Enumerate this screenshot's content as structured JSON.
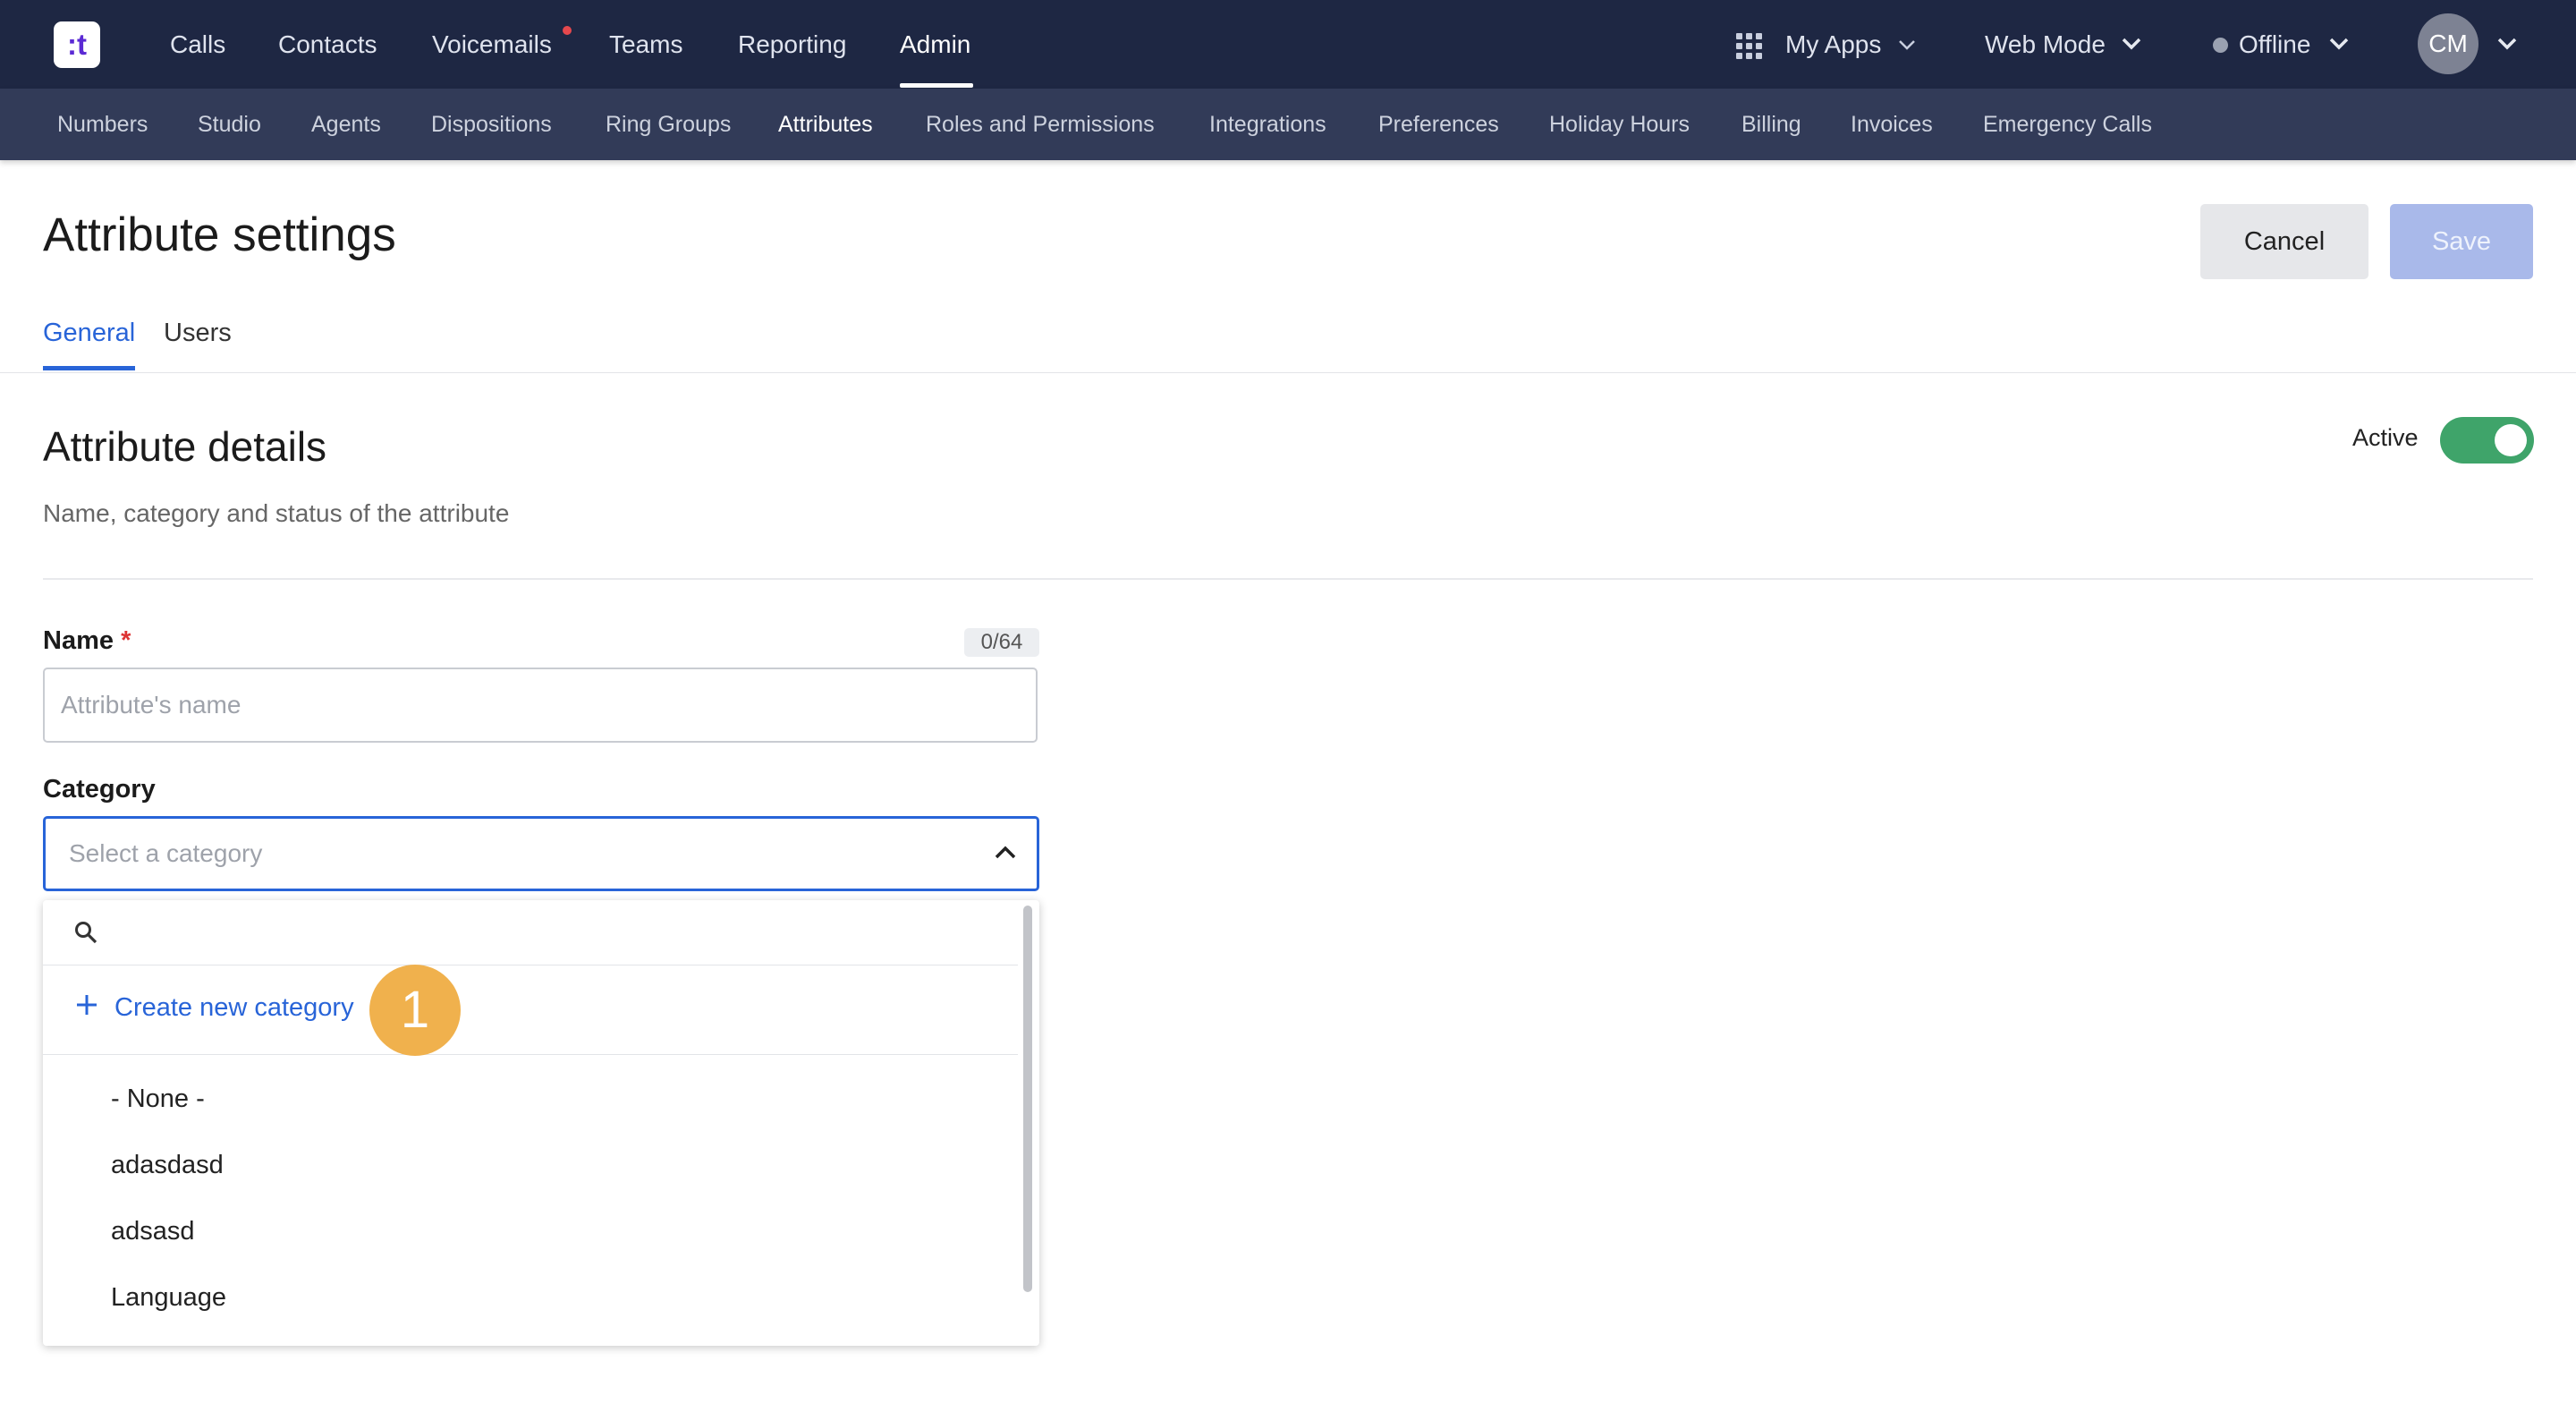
{
  "app": {
    "logo_text": ":t"
  },
  "topnav": {
    "items": [
      "Calls",
      "Contacts",
      "Voicemails",
      "Teams",
      "Reporting",
      "Admin"
    ],
    "active": "Admin",
    "my_apps": "My Apps",
    "web_mode": "Web Mode",
    "status": "Offline",
    "avatar_initials": "CM"
  },
  "subnav": {
    "items": [
      "Numbers",
      "Studio",
      "Agents",
      "Dispositions",
      "Ring Groups",
      "Attributes",
      "Roles and Permissions",
      "Integrations",
      "Preferences",
      "Holiday Hours",
      "Billing",
      "Invoices",
      "Emergency Calls"
    ],
    "active": "Attributes"
  },
  "page": {
    "title": "Attribute settings",
    "cancel_label": "Cancel",
    "save_label": "Save",
    "tabs": [
      "General",
      "Users"
    ],
    "active_tab": "General"
  },
  "section": {
    "title": "Attribute details",
    "subtitle": "Name, category and status of the attribute",
    "active_label": "Active",
    "active_on": true
  },
  "form": {
    "name_label": "Name",
    "required_mark": "*",
    "name_counter": "0/64",
    "name_placeholder": "Attribute's name",
    "name_value": "",
    "category_label": "Category",
    "category_placeholder": "Select a category"
  },
  "dropdown": {
    "search_value": "",
    "create_label": "Create new category",
    "options": [
      "- None -",
      "adasdasd",
      "adsasd",
      "Language"
    ]
  },
  "annotation": {
    "marker_number": "1",
    "marker_color": "#f0b14d"
  },
  "colors": {
    "nav_bg": "#1e2743",
    "subnav_bg": "#323b58",
    "accent": "#2864d8",
    "toggle_on": "#3fa46a",
    "save_disabled": "#a9b9ea"
  }
}
